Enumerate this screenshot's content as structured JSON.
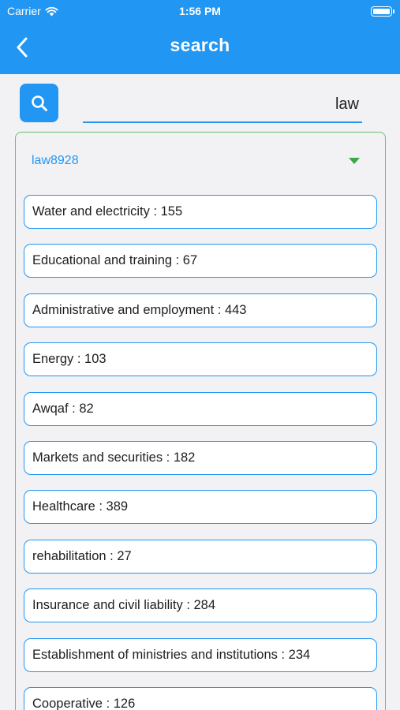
{
  "status_bar": {
    "carrier": "Carrier",
    "time": "1:56 PM"
  },
  "app_bar": {
    "title": "search",
    "back_icon": "chevron-left-icon"
  },
  "search": {
    "value": "law",
    "icon": "search-icon"
  },
  "results": {
    "title": "law8928",
    "expand_icon": "caret-down-icon",
    "items": [
      "Water and electricity : 155",
      "Educational and training : 67",
      "Administrative and employment : 443",
      "Energy : 103",
      "Awqaf : 82",
      "Markets and securities : 182",
      "Healthcare : 389",
      "rehabilitation : 27",
      "Insurance and civil liability : 284",
      "Establishment of ministries and institutions : 234",
      "Cooperative : 126"
    ]
  },
  "colors": {
    "primary": "#2196f3",
    "panel_border": "#6cc070",
    "chevron": "#3aa84a"
  }
}
